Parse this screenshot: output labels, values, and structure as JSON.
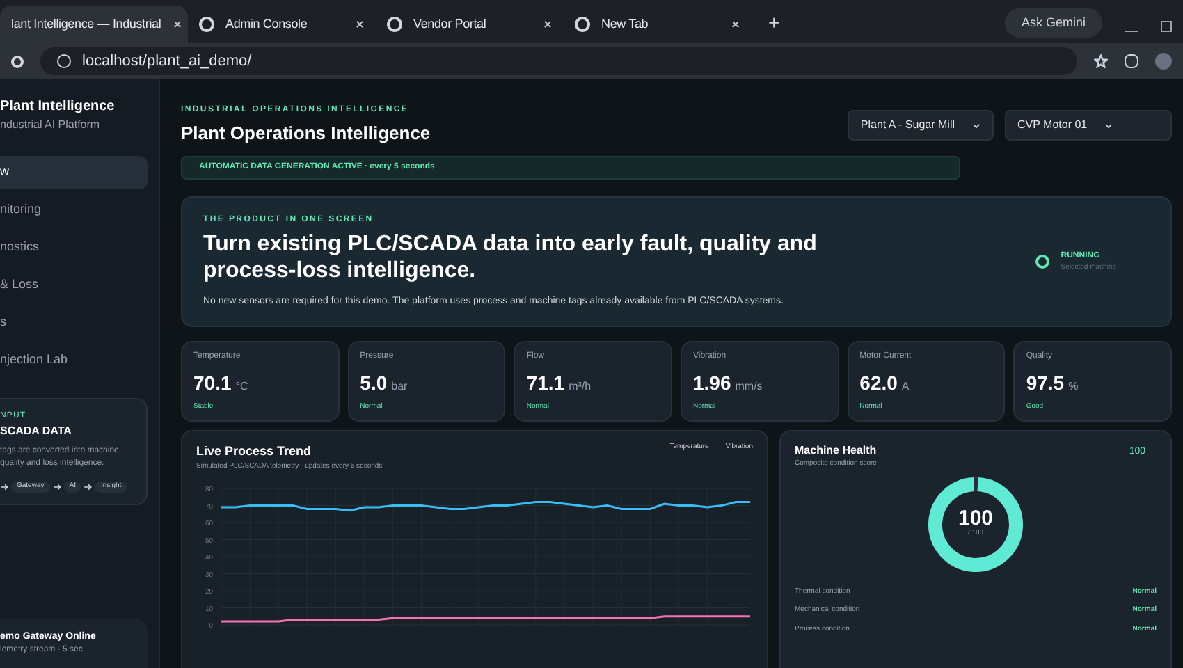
{
  "browser": {
    "tabs": [
      {
        "title": "lant Intelligence — Industrial",
        "selected": true
      },
      {
        "title": "Admin Console",
        "selected": false
      },
      {
        "title": "Vendor Portal",
        "selected": false
      },
      {
        "title": "New Tab",
        "selected": false
      }
    ],
    "new_tab": "+",
    "ask_button": "Ask Gemini",
    "address": "localhost/plant_ai_demo/"
  },
  "sidebar": {
    "brand": "Plant Intelligence",
    "subtitle": "ndustrial AI Platform",
    "items": [
      {
        "label": "w",
        "selected": true
      },
      {
        "label": "nitoring",
        "selected": false
      },
      {
        "label": "nostics",
        "selected": false
      },
      {
        "label": "& Loss",
        "selected": false
      },
      {
        "label": "s",
        "selected": false
      },
      {
        "label": "njection Lab",
        "selected": false
      }
    ],
    "input_card": {
      "eyebrow": "NPUT",
      "title": "SCADA DATA",
      "text": "tags are converted into machine, quality and loss intelligence.",
      "chips": [
        "Gateway",
        "AI",
        "Insight"
      ]
    },
    "gateway": {
      "title": "emo Gateway Online",
      "text": "lemetry stream · 5 sec"
    }
  },
  "header": {
    "eyebrow": "INDUSTRIAL OPERATIONS INTELLIGENCE",
    "title": "Plant Operations Intelligence",
    "plant_select": "Plant A - Sugar Mill",
    "asset_select": "CVP Motor 01",
    "banner": "AUTOMATIC DATA GENERATION ACTIVE · every 5 seconds"
  },
  "hero": {
    "eyebrow": "THE PRODUCT IN ONE SCREEN",
    "headline": "Turn existing PLC/SCADA data into early fault, quality and process-loss intelligence.",
    "text": "No new sensors are required for this demo. The platform uses process and machine tags already available from PLC/SCADA systems.",
    "status": "RUNNING",
    "status_sub": "Selected machine"
  },
  "metrics": [
    {
      "label": "Temperature",
      "value": "70.1",
      "unit": "°C",
      "status": "Stable"
    },
    {
      "label": "Pressure",
      "value": "5.0",
      "unit": "bar",
      "status": "Normal"
    },
    {
      "label": "Flow",
      "value": "71.1",
      "unit": "m³/h",
      "status": "Normal"
    },
    {
      "label": "Vibration",
      "value": "1.96",
      "unit": "mm/s",
      "status": "Normal"
    },
    {
      "label": "Motor Current",
      "value": "62.0",
      "unit": "A",
      "status": "Normal"
    },
    {
      "label": "Quality",
      "value": "97.5",
      "unit": "%",
      "status": "Good"
    }
  ],
  "trend": {
    "title": "Live Process Trend",
    "subtitle": "Simulated PLC/SCADA telemetry · updates every 5 seconds",
    "chart_data": {
      "type": "line",
      "grid": true,
      "ylim": [
        0,
        80
      ],
      "yticks": [
        0,
        10,
        20,
        30,
        40,
        50,
        60,
        70,
        80
      ],
      "series": [
        {
          "name": "Temperature",
          "color": "#38bdf8",
          "values": [
            69,
            69,
            70,
            70,
            70,
            70,
            68,
            68,
            68,
            67,
            69,
            69,
            70,
            70,
            70,
            69,
            68,
            68,
            69,
            70,
            70,
            71,
            72,
            72,
            71,
            70,
            69,
            70,
            68,
            68,
            68,
            71,
            70,
            70,
            69,
            70,
            72,
            72
          ]
        },
        {
          "name": "Vibration",
          "color": "#f472b6",
          "values": [
            2,
            2,
            2,
            2,
            2,
            3,
            3,
            3,
            3,
            3,
            3,
            3,
            4,
            4,
            4,
            4,
            4,
            4,
            4,
            4,
            4,
            4,
            4,
            4,
            4,
            4,
            4,
            4,
            4,
            4,
            4,
            5,
            5,
            5,
            5,
            5,
            5,
            5
          ]
        }
      ]
    }
  },
  "health": {
    "title": "Machine Health",
    "subtitle": "Composite condition score",
    "score_badge": "100",
    "score": "100",
    "score_max": "/ 100",
    "level": 1,
    "conditions": [
      {
        "label": "Thermal condition",
        "status": "Normal"
      },
      {
        "label": "Mechanical condition",
        "status": "Normal"
      },
      {
        "label": "Process condition",
        "status": "Normal"
      }
    ]
  }
}
